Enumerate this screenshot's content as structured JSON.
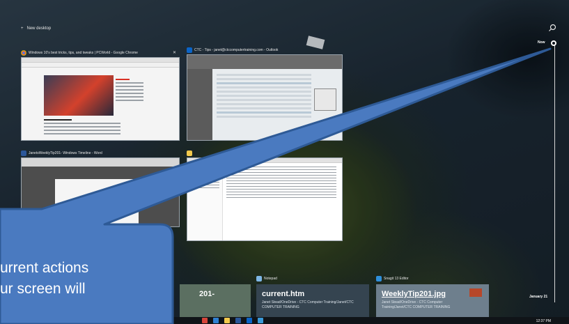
{
  "desktop": {
    "new_desktop_label": "New desktop"
  },
  "windows": {
    "chrome": {
      "title": "Windows 10's best tricks, tips, and tweaks | PCWorld - Google Chrome",
      "icon": "chrome-icon"
    },
    "outlook": {
      "title": "CTC - Tips - janet@ctccomputertraining.com - Outlook",
      "icon": "outlook-icon"
    },
    "word": {
      "title": "JanetsWeeklyTip201- Windows Timeline - Word",
      "icon": "word-icon"
    },
    "explorer": {
      "title": "",
      "icon": "file-explorer-icon"
    }
  },
  "timeline": {
    "now_label": "Now",
    "date_label": "January 21"
  },
  "activities": [
    {
      "app": "",
      "title": "201-",
      "subtitle": ""
    },
    {
      "app": "Notepad",
      "title": "current.htm",
      "subtitle": "Janet Stead/OneDrive - CTC Computer Training/Janet/CTC COMPUTER TRAINING"
    },
    {
      "app": "Snagit 13 Editor",
      "title": "WeeklyTip201.jpg",
      "subtitle": "Janet Stead/OneDrive - CTC Computer Training/Janet/CTC COMPUTER TRAINING"
    }
  ],
  "callout": {
    "line1": "urrent actions",
    "line2": "ur screen will"
  },
  "taskbar": {
    "clock": "12:37 PM"
  },
  "colors": {
    "callout_fill": "#4a7ac0",
    "callout_border": "#2e5a96",
    "card_notepad": "#354450",
    "card_snagit": "#6e7f8d",
    "card_word": "#5b6f61"
  }
}
